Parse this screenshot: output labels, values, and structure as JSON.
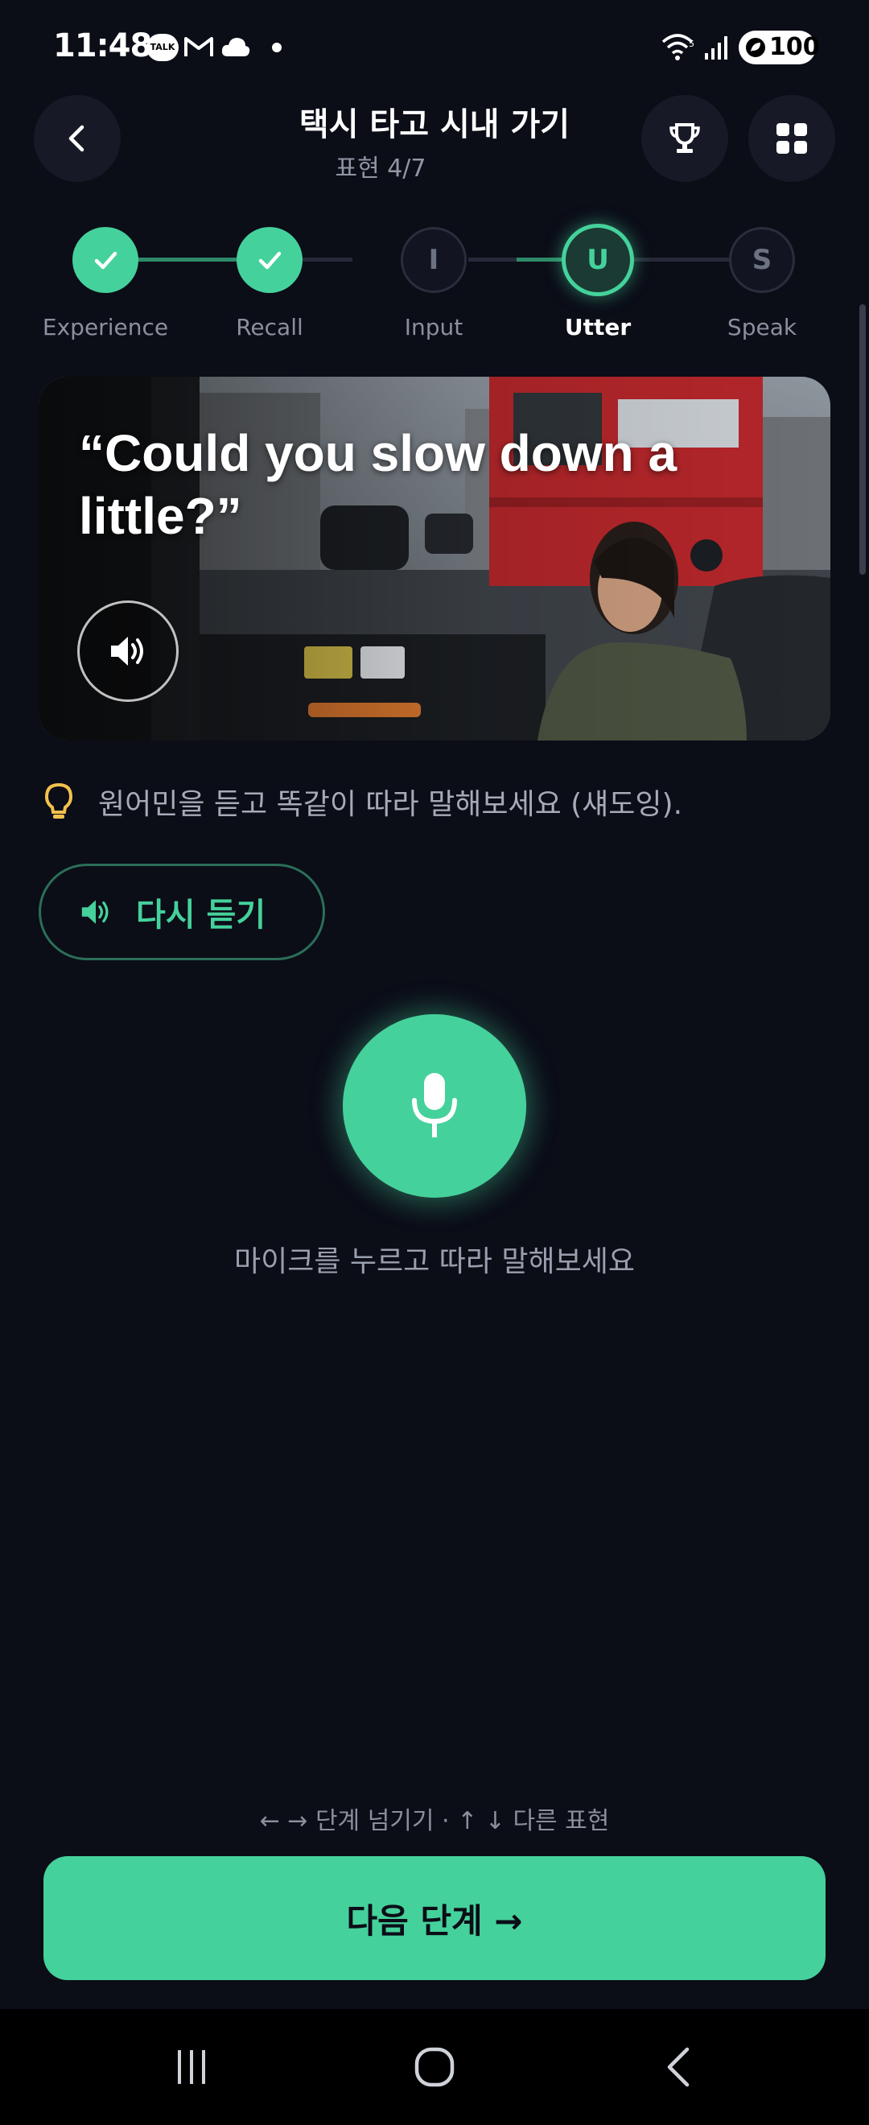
{
  "status_bar": {
    "time": "11:48",
    "talk_badge": "TALK",
    "battery": "100",
    "icons": [
      "kakaotalk-icon",
      "gmail-icon",
      "cloud-icon",
      "dot-icon",
      "wifi-icon",
      "signal-icon",
      "battery-icon"
    ]
  },
  "header": {
    "title": "택시 타고 시내 가기",
    "subtitle": "표현 4/7"
  },
  "stepper": {
    "steps": [
      {
        "label": "Experience",
        "letter": "",
        "state": "done"
      },
      {
        "label": "Recall",
        "letter": "",
        "state": "done"
      },
      {
        "label": "Input",
        "letter": "I",
        "state": "todo"
      },
      {
        "label": "Utter",
        "letter": "U",
        "state": "current"
      },
      {
        "label": "Speak",
        "letter": "S",
        "state": "todo"
      }
    ]
  },
  "card": {
    "quote": "“Could you slow down a little?”"
  },
  "tip": {
    "text": "원어민을 듣고 똑같이 따라 말해보세요 (섀도잉)."
  },
  "replay": {
    "label": "다시 듣기"
  },
  "mic": {
    "caption": "마이크를 누르고 따라 말해보세요"
  },
  "hint": {
    "text": "← → 단계 넘기기  ·  ↑ ↓ 다른 표현"
  },
  "next_button": {
    "label": "다음 단계 →"
  },
  "colors": {
    "accent": "#45d19b",
    "background": "#0b0d17",
    "tip_icon": "#f2c14e"
  }
}
